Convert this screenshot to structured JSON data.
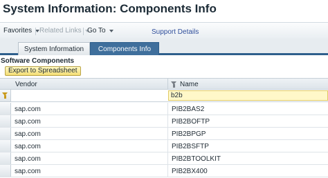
{
  "page": {
    "title": "System Information: Components Info"
  },
  "menu": {
    "favorites": "Favorites",
    "related_links": "Related Links",
    "go_to": "Go To",
    "support_details": "Support Details"
  },
  "tabs": [
    {
      "label": "System Information",
      "active": false
    },
    {
      "label": "Components Info",
      "active": true
    }
  ],
  "section": {
    "title": "Software Components",
    "export_button": "Export to Spreadsheet"
  },
  "table": {
    "columns": [
      "Vendor",
      "Name"
    ],
    "filter": {
      "vendor": "",
      "name": "b2b"
    },
    "rows": [
      {
        "vendor": "sap.com",
        "name": "PIB2BAS2"
      },
      {
        "vendor": "sap.com",
        "name": "PIB2BOFTP"
      },
      {
        "vendor": "sap.com",
        "name": "PIB2BPGP"
      },
      {
        "vendor": "sap.com",
        "name": "PIB2BSFTP"
      },
      {
        "vendor": "sap.com",
        "name": "PIB2BTOOLKIT"
      },
      {
        "vendor": "sap.com",
        "name": "PIB2BX400"
      }
    ]
  },
  "icons": {
    "filter_column": "funnel-icon",
    "filter_row": "funnel-icon",
    "dropdown": "chevron-down-icon"
  },
  "colors": {
    "active_tab": "#3f6f9c",
    "tab_strip_border": "#2e5f8c",
    "export_button": "#f4dd73",
    "filter_active_input": "#fff8c9",
    "link": "#2f4e9b"
  }
}
